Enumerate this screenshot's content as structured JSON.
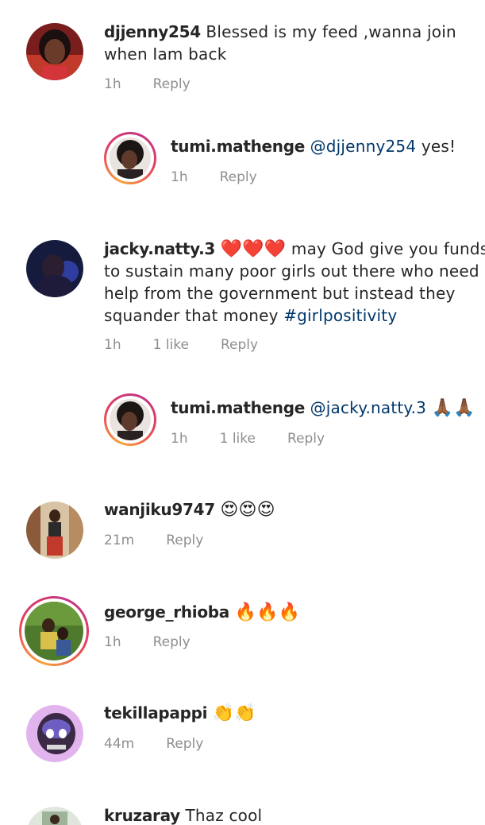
{
  "comments": [
    {
      "username": "djjenny254",
      "text_line1": "Blessed is my feed ,wanna join",
      "text_line2": "when Iam back",
      "time": "1h",
      "reply": "Reply"
    },
    {
      "username": "tumi.mathenge",
      "mention": "@djjenny254",
      "text": "yes!",
      "time": "1h",
      "reply": "Reply"
    },
    {
      "username": "jacky.natty.3",
      "hearts": "❤️❤️❤️",
      "text_line1": "may God give you funds",
      "text_line2": "to sustain many poor girls out there who need",
      "text_line3": "help from the government but instead they",
      "text_line4": "squander that money",
      "hashtag": "#girlpositivity",
      "time": "1h",
      "likes": "1 like",
      "reply": "Reply"
    },
    {
      "username": "tumi.mathenge",
      "mention": "@jacky.natty.3",
      "emoji": "🙏🏾🙏🏾",
      "time": "1h",
      "likes": "1 like",
      "reply": "Reply"
    },
    {
      "username": "wanjiku9747",
      "emoji": "😍😍😍",
      "time": "21m",
      "reply": "Reply"
    },
    {
      "username": "george_rhioba",
      "emoji": "🔥🔥🔥",
      "time": "1h",
      "reply": "Reply"
    },
    {
      "username": "tekillapappi",
      "emoji": "👏👏",
      "time": "44m",
      "reply": "Reply"
    },
    {
      "username": "kruzaray",
      "text": "Thaz cool"
    }
  ]
}
